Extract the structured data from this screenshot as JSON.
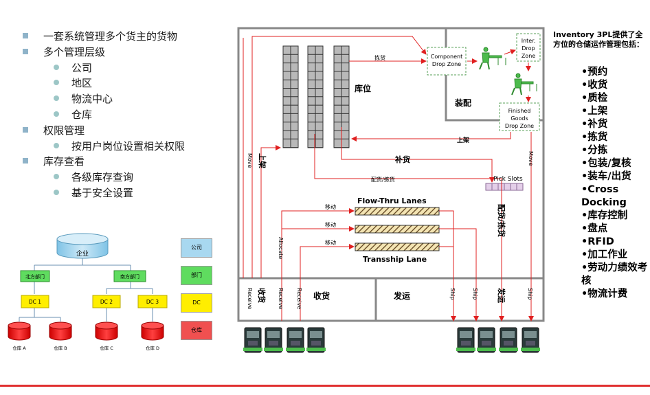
{
  "left_bullets": [
    {
      "level": 1,
      "text": "一套系统管理多个货主的货物"
    },
    {
      "level": 1,
      "text": "多个管理层级"
    },
    {
      "level": 2,
      "text": "公司"
    },
    {
      "level": 2,
      "text": "地区"
    },
    {
      "level": 2,
      "text": "物流中心"
    },
    {
      "level": 2,
      "text": "仓库"
    },
    {
      "level": 1,
      "text": "权限管理"
    },
    {
      "level": 2,
      "text": "按用户岗位设置相关权限"
    },
    {
      "level": 1,
      "text": "库存查看"
    },
    {
      "level": 2,
      "text": "各级库存查询"
    },
    {
      "level": 2,
      "text": "基于安全设置"
    }
  ],
  "org_tree": {
    "root": "企业",
    "regions": [
      "北方部门",
      "南方部门"
    ],
    "dcs": [
      "DC 1",
      "DC 2",
      "DC 3"
    ],
    "warehouses": [
      "仓库 A",
      "仓库 B",
      "仓库 C",
      "仓库 D"
    ]
  },
  "legend": [
    {
      "label": "公司",
      "color": "#a8d8f0"
    },
    {
      "label": "部门",
      "color": "#5fdc5f"
    },
    {
      "label": "DC",
      "color": "#ffee00"
    },
    {
      "label": "仓库",
      "color": "#f05050"
    }
  ],
  "warehouse": {
    "storage_label": "库位",
    "assembly_label": "装配",
    "component_zone": "Component Drop Zone",
    "inter_zone": "Inter. Drop Zone",
    "finished_zone": "Finished Goods Drop Zone",
    "pick_slots": "Pick Slots",
    "flow_thru": "Flow-Thru Lanes",
    "transship": "Transship Lane",
    "receive_area": "收货",
    "ship_area": "发运",
    "receive_area_left": "收货",
    "ship_area_right": "发运",
    "labels": {
      "pick": "拣货",
      "putaway_top": "上架",
      "putaway_left": "上架",
      "replenish": "补货",
      "dispatch_pick": "配货/拣货",
      "dispatch_pick_v": "配货/拣货",
      "move_left": "Move",
      "move_right": "Move",
      "allocate": "Allocate",
      "receive1": "Receive",
      "receive2": "Receive",
      "receive3": "Receive",
      "ship1": "Ship",
      "ship2": "Ship",
      "ship3": "Ship",
      "move1": "移动",
      "move2": "移动",
      "move3": "移动"
    }
  },
  "right_title": "Inventory 3PL提供了全方位的仓储运作管理包括：",
  "right_list": [
    "•预约",
    "•收货",
    "•质检",
    "•上架",
    "•补货",
    "•拣货",
    "•分拣",
    "•包装/复核",
    "•装车/出货",
    "•Cross Docking",
    "•库存控制",
    "•盘点",
    "•RFID",
    "•加工作业",
    "•劳动力绩效考核",
    "•物流计费"
  ]
}
